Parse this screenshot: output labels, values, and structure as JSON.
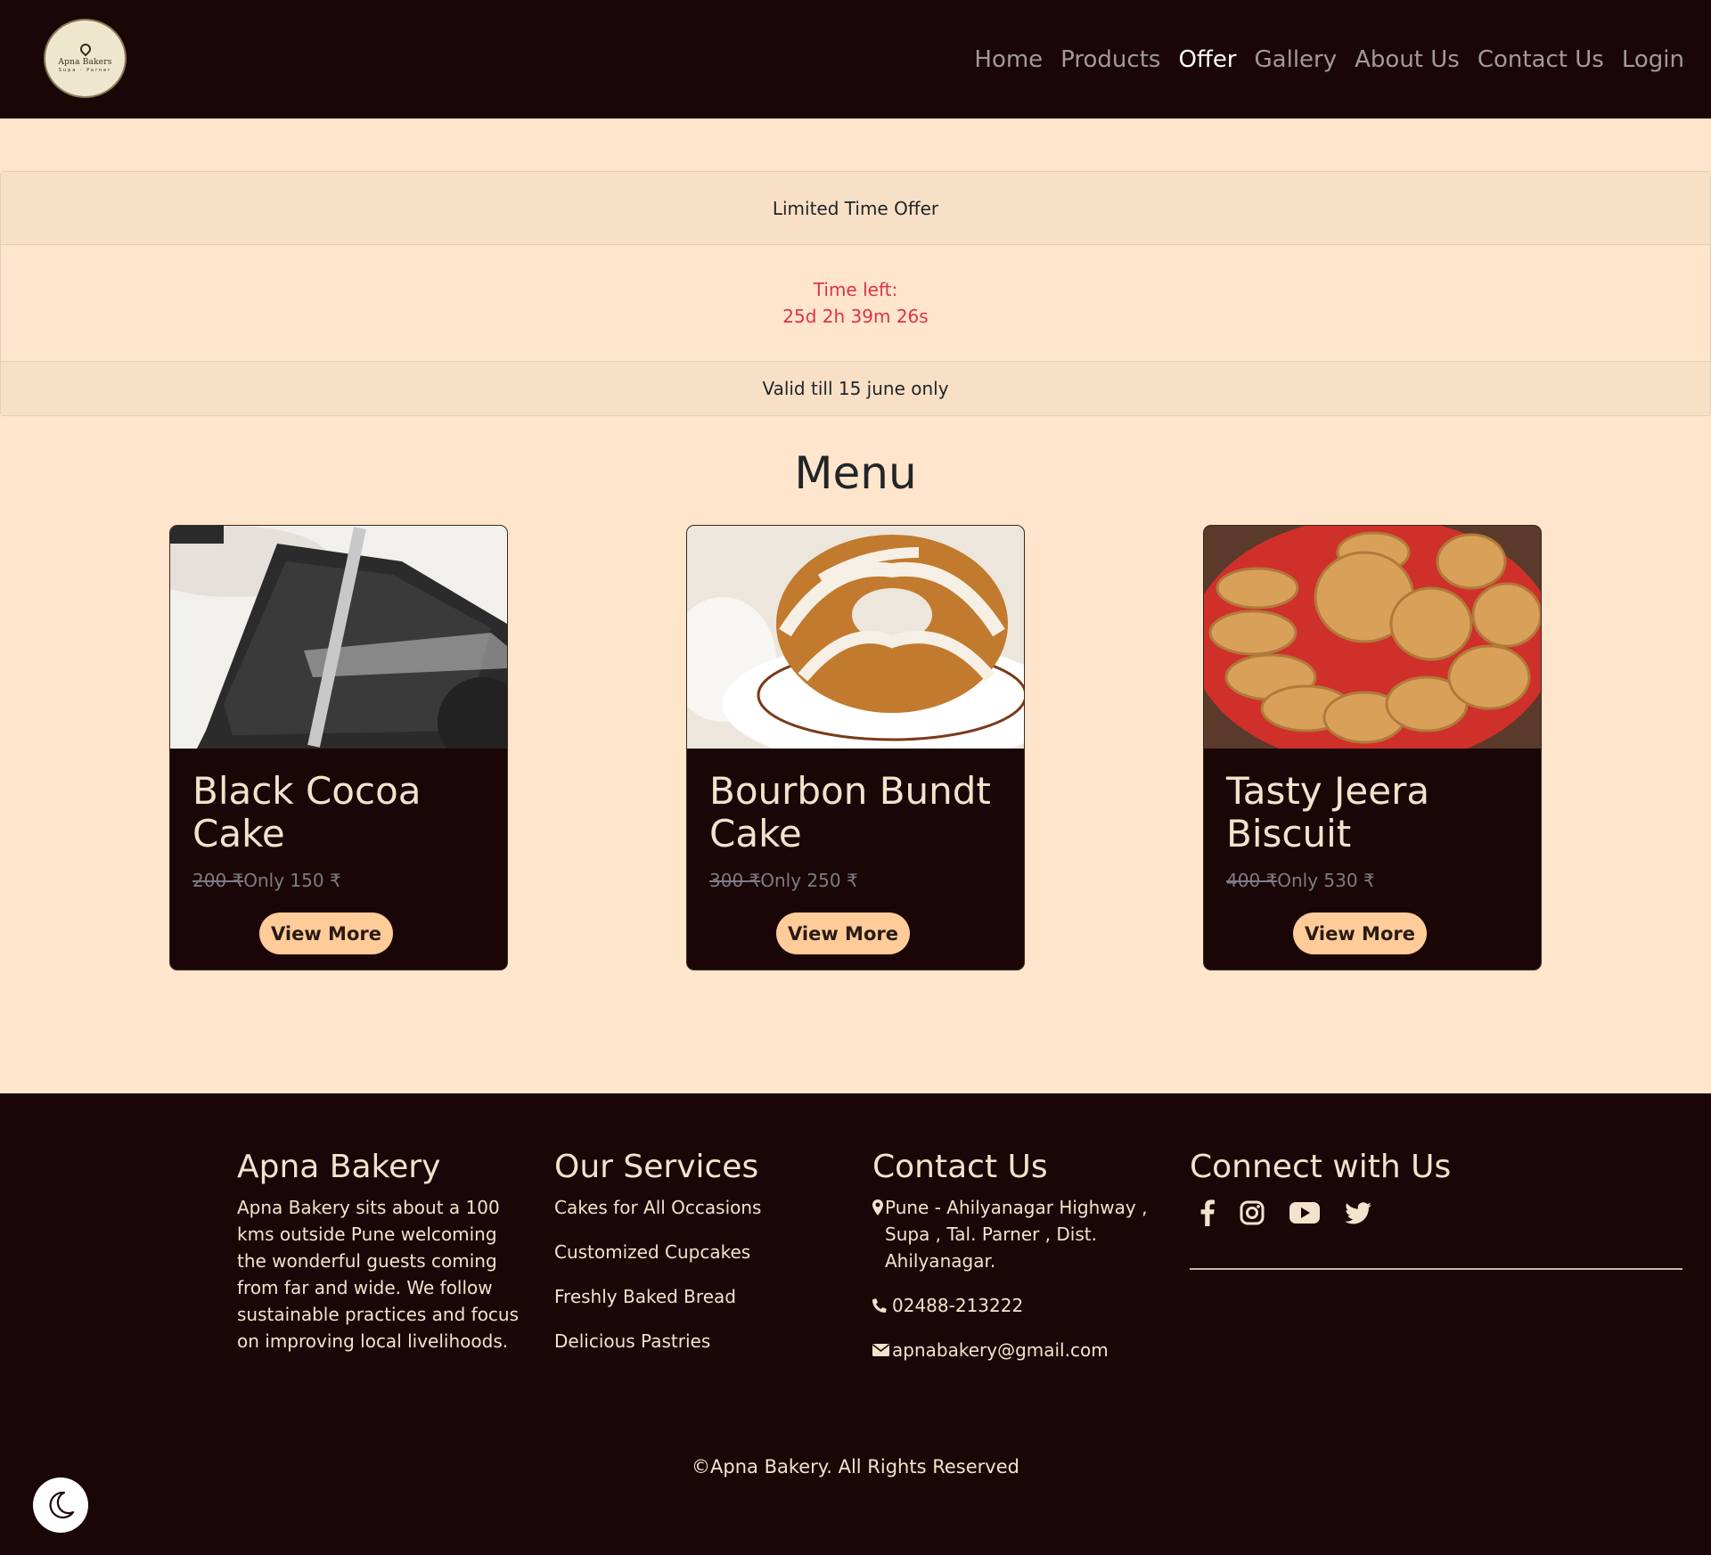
{
  "brand": {
    "logo_name": "Apna Bakers",
    "logo_sub": "Supa · Parner"
  },
  "nav": {
    "items": [
      "Home",
      "Products",
      "Offer",
      "Gallery",
      "About Us",
      "Contact Us",
      "Login"
    ],
    "active": "Offer"
  },
  "offer": {
    "header": "Limited Time Offer",
    "time_left_label": "Time left:",
    "countdown": "25d 2h 39m 26s",
    "footer": "Valid till 15 june only"
  },
  "menu": {
    "title": "Menu",
    "items": [
      {
        "name": "Black Cocoa Cake",
        "old_price": "200 ₹",
        "new_price": "Only 150 ₹",
        "button": "View More"
      },
      {
        "name": "Bourbon Bundt Cake",
        "old_price": "300 ₹",
        "new_price": "Only 250 ₹",
        "button": "View More"
      },
      {
        "name": "Tasty Jeera Biscuit",
        "old_price": "400 ₹",
        "new_price": "Only 530 ₹",
        "button": "View More"
      }
    ]
  },
  "footer": {
    "about": {
      "title": "Apna Bakery",
      "text": "Apna Bakery sits about a 100 kms outside Pune welcoming the wonderful guests coming from far and wide. We follow sustainable practices and focus on improving local livelihoods."
    },
    "services": {
      "title": "Our Services",
      "items": [
        "Cakes for All Occasions",
        "Customized Cupcakes",
        "Freshly Baked Bread",
        "Delicious Pastries"
      ]
    },
    "contact": {
      "title": "Contact Us",
      "address": "Pune - Ahilyanagar Highway , Supa , Tal. Parner , Dist. Ahilyanagar.",
      "phone": "02488-213222",
      "email": "apnabakery@gmail.com"
    },
    "connect": {
      "title": "Connect with Us",
      "icons": [
        "facebook-icon",
        "instagram-icon",
        "youtube-icon",
        "twitter-icon"
      ]
    },
    "copyright": "©Apna Bakery. All Rights Reserved"
  },
  "colors": {
    "dark": "#1a0606",
    "background": "#ffe5cb",
    "accent": "#ffcc99",
    "countdown": "#dc3545"
  }
}
